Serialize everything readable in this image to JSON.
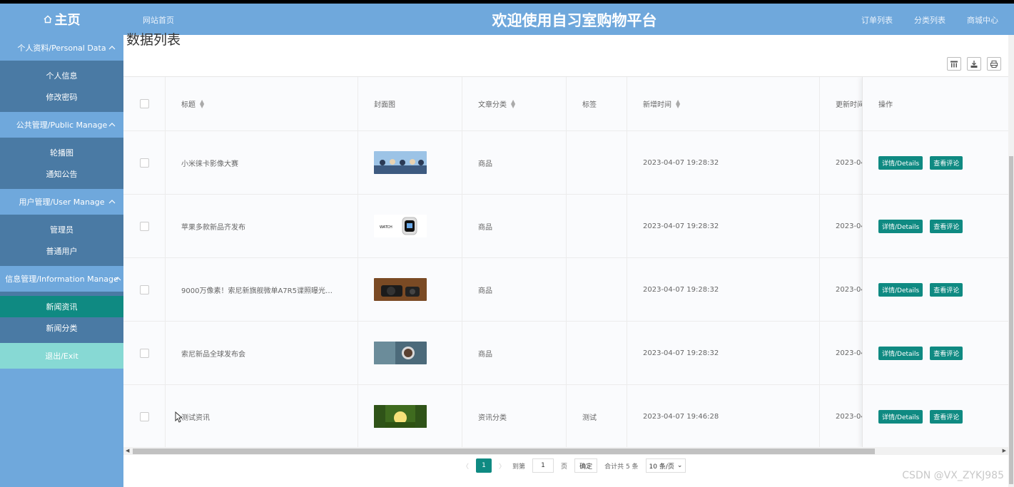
{
  "header": {
    "brand": "主页",
    "nav_home": "网站首页",
    "site_title": "欢迎使用自习室购物平台",
    "right_nav": [
      "订单列表",
      "分类列表",
      "商城中心"
    ]
  },
  "sidebar": {
    "groups": [
      {
        "title": "个人资料/Personal Data",
        "items": [
          "个人信息",
          "修改密码"
        ]
      },
      {
        "title": "公共管理/Public Manage",
        "items": [
          "轮播图",
          "通知公告"
        ]
      },
      {
        "title": "用户管理/User Manage",
        "items": [
          "管理员",
          "普通用户"
        ]
      },
      {
        "title": "信息管理/Information Manage",
        "items": [
          "新闻资讯",
          "新闻分类"
        ]
      }
    ],
    "active_item": "新闻资讯",
    "exit_label": "退出/Exit"
  },
  "main": {
    "page_title": "数据列表",
    "columns": [
      "标题",
      "封面图",
      "文章分类",
      "标签",
      "新增时间",
      "更新时间",
      "操作"
    ],
    "rows": [
      {
        "title": "小米徕卡影像大赛",
        "category": "商品",
        "tag": "",
        "created": "2023-04-07 19:28:32",
        "updated": "2023-04",
        "thumb": "people"
      },
      {
        "title": "苹果多款新品齐发布",
        "category": "商品",
        "tag": "",
        "created": "2023-04-07 19:28:32",
        "updated": "2023-04",
        "thumb": "watch"
      },
      {
        "title": "9000万像素！索尼新旗舰微单A7R5谍照曝光…",
        "category": "商品",
        "tag": "",
        "created": "2023-04-07 19:28:32",
        "updated": "2023-04",
        "thumb": "camera"
      },
      {
        "title": "索尼新品全球发布会",
        "category": "商品",
        "tag": "",
        "created": "2023-04-07 19:28:32",
        "updated": "2023-04",
        "thumb": "astronaut"
      },
      {
        "title": "测试资讯",
        "category": "资讯分类",
        "tag": "测试",
        "created": "2023-04-07 19:46:28",
        "updated": "2023-04",
        "thumb": "sunset"
      }
    ],
    "details_label": "详情/Details",
    "comments_label": "查看评论"
  },
  "pagination": {
    "current_page": "1",
    "goto_label": "到第",
    "goto_value": "1",
    "page_unit": "页",
    "confirm_label": "确定",
    "total_label": "合计共 5 条",
    "page_size": "10 条/页"
  },
  "watermark": "CSDN @VX_ZYKJ985",
  "colors": {
    "header_bg": "#6fa8dc",
    "active_item": "#0f8a82",
    "exit_bg": "#87d9d4",
    "button": "#0f8a82"
  }
}
